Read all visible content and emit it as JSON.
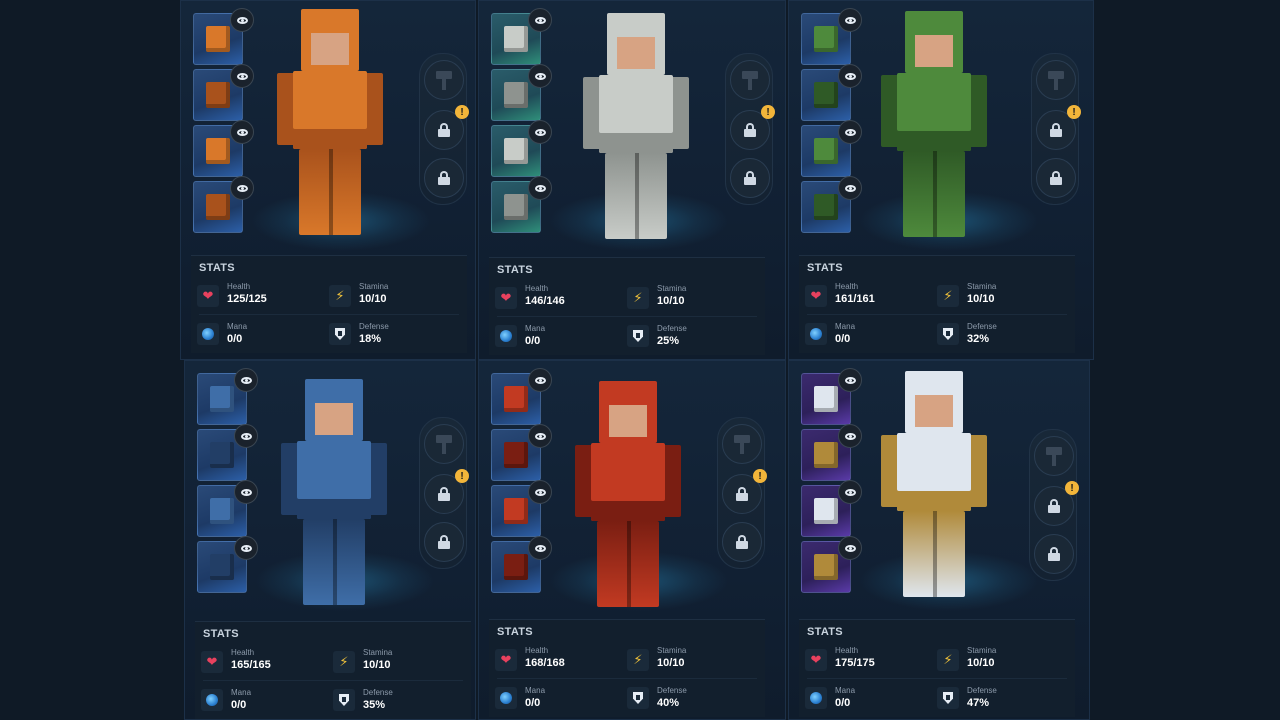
{
  "stats_title": "STATS",
  "labels": {
    "health": "Health",
    "stamina": "Stamina",
    "mana": "Mana",
    "defense": "Defense"
  },
  "icons": {
    "visibility": "eye-icon",
    "ability_locked": "lock-icon",
    "ability_craft": "hammer-icon",
    "alert": "exclamation-icon",
    "health": "heart-icon",
    "stamina": "lightning-bolt-icon",
    "mana": "mana-orb-icon",
    "defense": "shield-icon"
  },
  "alert_symbol": "!",
  "health_glyph": "❤",
  "stamina_glyph": "⚡",
  "colors": {
    "background": "#0f1a26",
    "health": "#e8415e",
    "stamina": "#f0c23a",
    "alert": "#f2b53a"
  },
  "armor_sets": [
    {
      "material": "copper",
      "slot_tint": "blue",
      "primary": "#d9782a",
      "secondary": "#a9521c",
      "stats": {
        "health": "125/125",
        "stamina": "10/10",
        "mana": "0/0",
        "defense": "18%"
      }
    },
    {
      "material": "iron",
      "slot_tint": "teal",
      "primary": "#c8ccc8",
      "secondary": "#8e938f",
      "stats": {
        "health": "146/146",
        "stamina": "10/10",
        "mana": "0/0",
        "defense": "25%"
      }
    },
    {
      "material": "jade",
      "slot_tint": "blue",
      "primary": "#4e8a3c",
      "secondary": "#2f5a26",
      "stats": {
        "health": "161/161",
        "stamina": "10/10",
        "mana": "0/0",
        "defense": "32%"
      }
    },
    {
      "material": "cobalt",
      "slot_tint": "blue",
      "primary": "#3f6ea8",
      "secondary": "#223e66",
      "stats": {
        "health": "165/165",
        "stamina": "10/10",
        "mana": "0/0",
        "defense": "35%"
      }
    },
    {
      "material": "crimson",
      "slot_tint": "blue",
      "primary": "#c23a22",
      "secondary": "#7a1e12",
      "stats": {
        "health": "168/168",
        "stamina": "10/10",
        "mana": "0/0",
        "defense": "40%"
      }
    },
    {
      "material": "mithril",
      "slot_tint": "purple",
      "primary": "#dfe6ee",
      "secondary": "#b08a3a",
      "stats": {
        "health": "175/175",
        "stamina": "10/10",
        "mana": "0/0",
        "defense": "47%"
      }
    }
  ]
}
